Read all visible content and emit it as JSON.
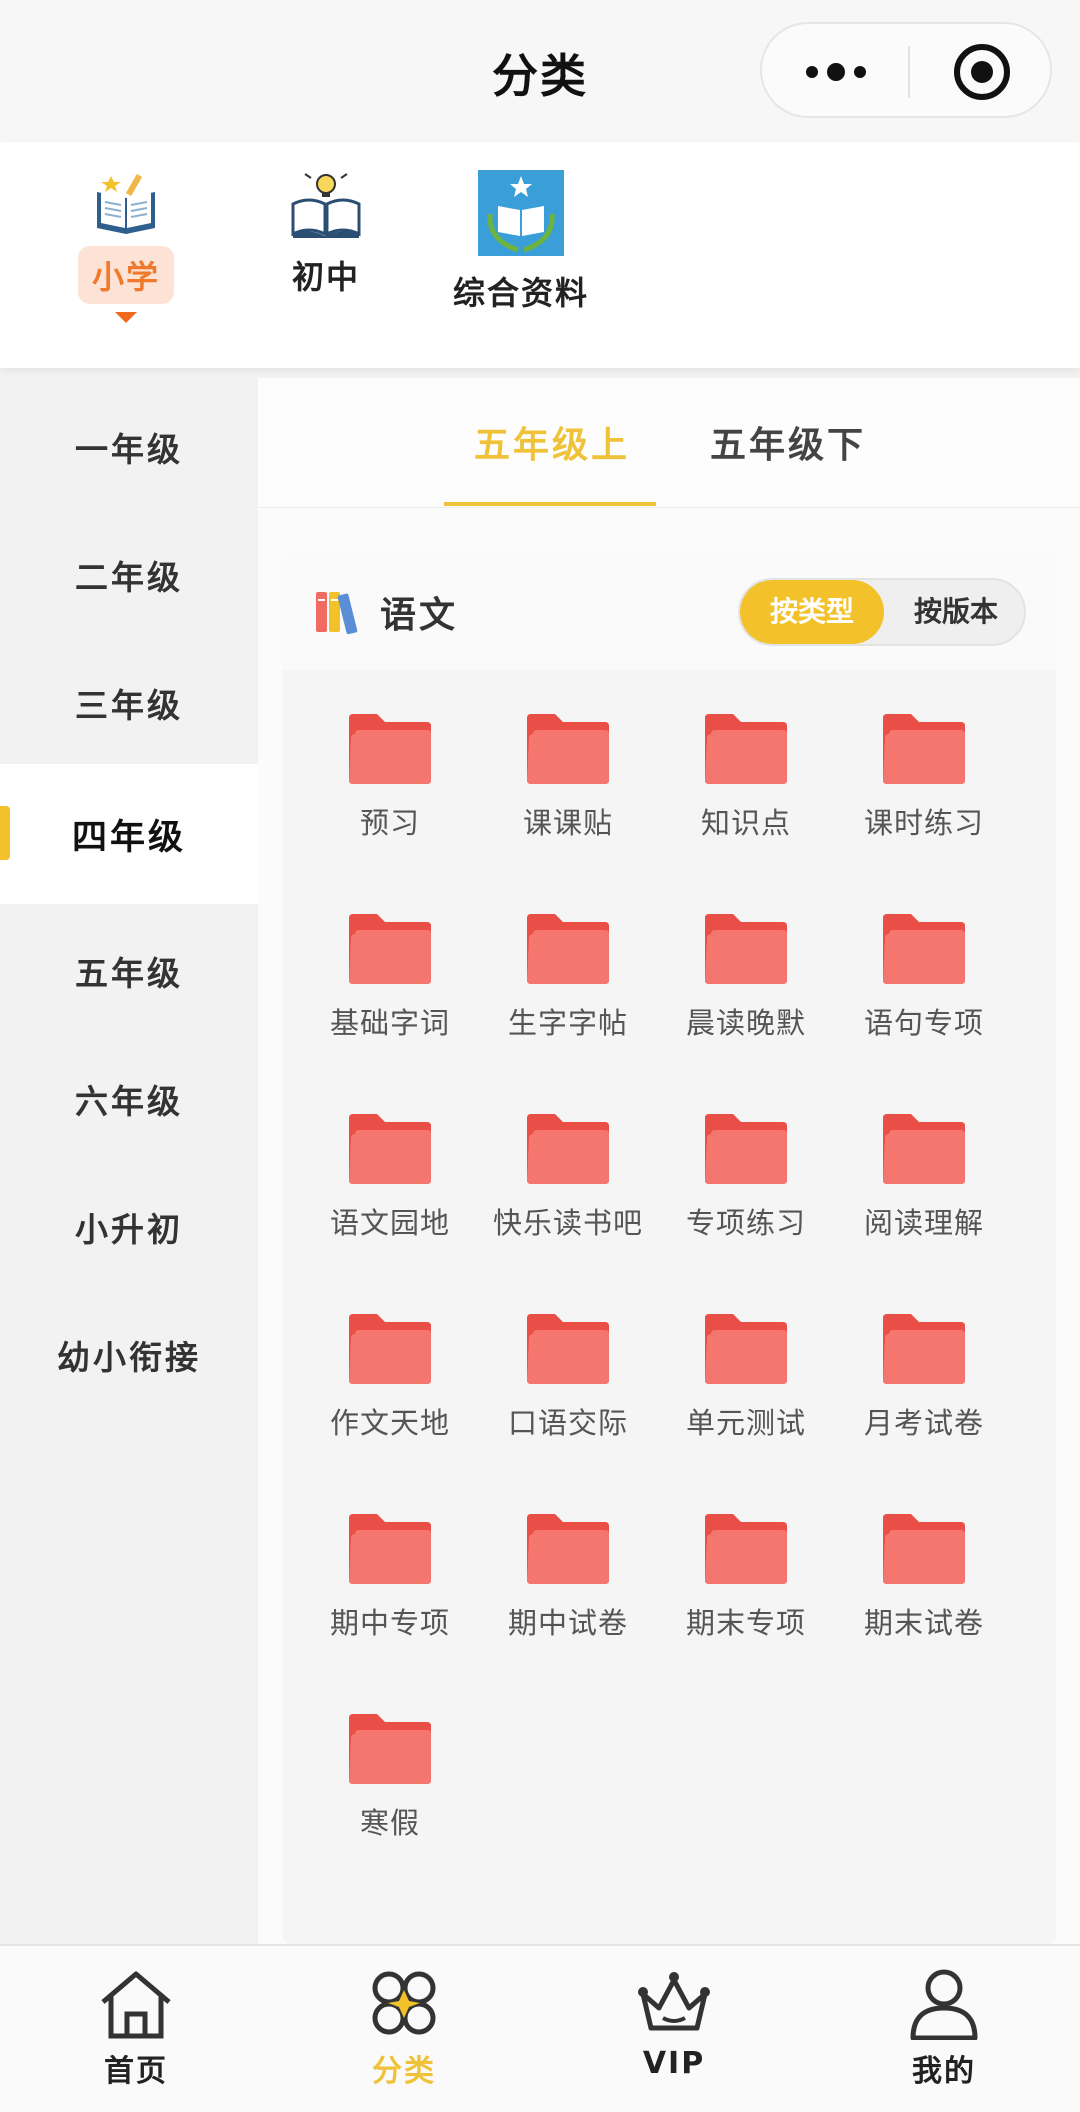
{
  "nav": {
    "title": "分类"
  },
  "levels": [
    {
      "label": "小学",
      "icon": "open-book-pencil-icon",
      "active": true
    },
    {
      "label": "初中",
      "icon": "book-lightbulb-icon",
      "active": false
    },
    {
      "label": "综合资料",
      "icon": "school-emblem-icon",
      "active": false
    }
  ],
  "grades": [
    {
      "label": "一年级",
      "active": false
    },
    {
      "label": "二年级",
      "active": false
    },
    {
      "label": "三年级",
      "active": false
    },
    {
      "label": "四年级",
      "active": true
    },
    {
      "label": "五年级",
      "active": false
    },
    {
      "label": "六年级",
      "active": false
    },
    {
      "label": "小升初",
      "active": false
    },
    {
      "label": "幼小衔接",
      "active": false
    }
  ],
  "terms": [
    {
      "label": "五年级上",
      "active": true
    },
    {
      "label": "五年级下",
      "active": false
    }
  ],
  "subject": {
    "name": "语文",
    "toggle": {
      "by_type": "按类型",
      "by_edition": "按版本",
      "selected": "按类型"
    }
  },
  "folders": [
    "预习",
    "课课贴",
    "知识点",
    "课时练习",
    "基础字词",
    "生字字帖",
    "晨读晚默",
    "语句专项",
    "语文园地",
    "快乐读书吧",
    "专项练习",
    "阅读理解",
    "作文天地",
    "口语交际",
    "单元测试",
    "月考试卷",
    "期中专项",
    "期中试卷",
    "期末专项",
    "期末试卷",
    "寒假"
  ],
  "colors": {
    "accent": "#f0c23a",
    "level_active_bg": "#fde3d6",
    "level_active_text": "#f0792c",
    "folder": "#f26b63"
  },
  "tabbar": [
    {
      "label": "首页",
      "icon": "home-icon",
      "active": false
    },
    {
      "label": "分类",
      "icon": "category-icon",
      "active": true
    },
    {
      "label": "VIP",
      "icon": "crown-icon",
      "active": false
    },
    {
      "label": "我的",
      "icon": "user-icon",
      "active": false
    }
  ]
}
